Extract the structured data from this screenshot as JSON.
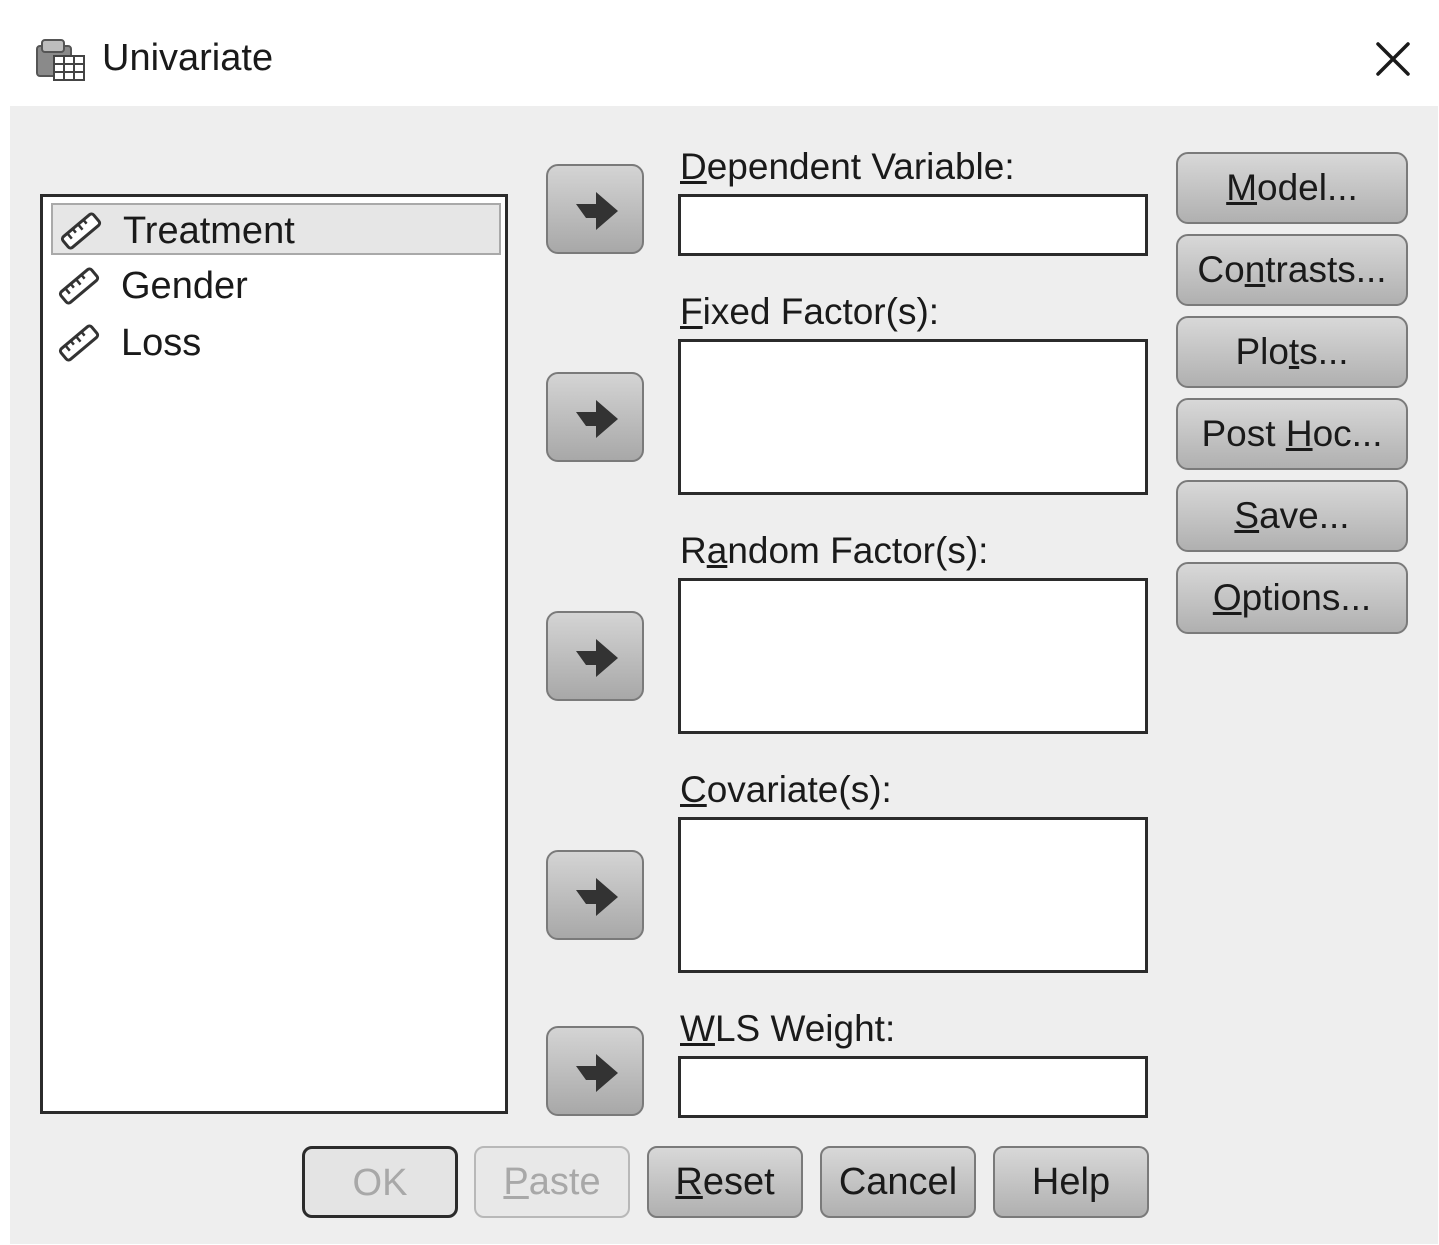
{
  "window": {
    "title": "Univariate",
    "icon": "dataset-table-icon",
    "close_icon": "close-x-icon"
  },
  "variables": [
    {
      "name": "Treatment",
      "icon": "scale-ruler-icon",
      "selected": true
    },
    {
      "name": "Gender",
      "icon": "scale-ruler-icon",
      "selected": false
    },
    {
      "name": "Loss",
      "icon": "scale-ruler-icon",
      "selected": false
    }
  ],
  "fields": {
    "dependent": {
      "label_pre": "",
      "label_key": "D",
      "label_post": "ependent Variable:",
      "value": ""
    },
    "fixed": {
      "label_pre": "",
      "label_key": "F",
      "label_post": "ixed Factor(s):",
      "value": ""
    },
    "random": {
      "label_pre": "R",
      "label_key": "a",
      "label_post": "ndom Factor(s):",
      "value": ""
    },
    "covariate": {
      "label_pre": "",
      "label_key": "C",
      "label_post": "ovariate(s):",
      "value": ""
    },
    "wls": {
      "label_pre": "",
      "label_key": "W",
      "label_post": "LS Weight:",
      "value": ""
    }
  },
  "side_buttons": [
    {
      "pre": "",
      "key": "M",
      "post": "odel..."
    },
    {
      "pre": "Co",
      "key": "n",
      "post": "trasts..."
    },
    {
      "pre": "Plo",
      "key": "t",
      "post": "s..."
    },
    {
      "pre": "Post ",
      "key": "H",
      "post": "oc..."
    },
    {
      "pre": "",
      "key": "S",
      "post": "ave..."
    },
    {
      "pre": "",
      "key": "O",
      "post": "ptions..."
    }
  ],
  "bottom_buttons": [
    {
      "pre": "OK",
      "key": "",
      "post": "",
      "state": "disabled-default"
    },
    {
      "pre": "",
      "key": "P",
      "post": "aste",
      "state": "disabled"
    },
    {
      "pre": "",
      "key": "R",
      "post": "eset",
      "state": "enabled"
    },
    {
      "pre": "Cancel",
      "key": "",
      "post": "",
      "state": "enabled"
    },
    {
      "pre": "Help",
      "key": "",
      "post": "",
      "state": "enabled"
    }
  ],
  "colors": {
    "dialog_bg": "#eeeeee",
    "button_face": "#c4c4c4",
    "disabled_text": "#a8a8a8"
  }
}
